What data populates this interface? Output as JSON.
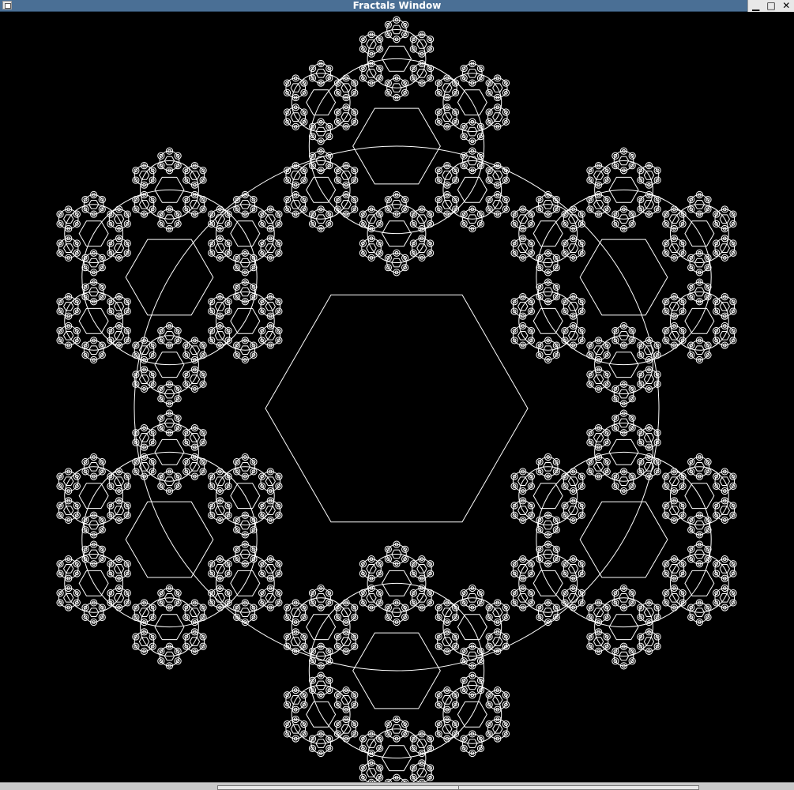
{
  "window": {
    "title": "Fractals Window",
    "minimize_label": "▁",
    "maximize_label": "□",
    "close_label": "✕"
  },
  "fractal": {
    "background": "#000000",
    "stroke": "#ffffff",
    "depth": 4
  }
}
